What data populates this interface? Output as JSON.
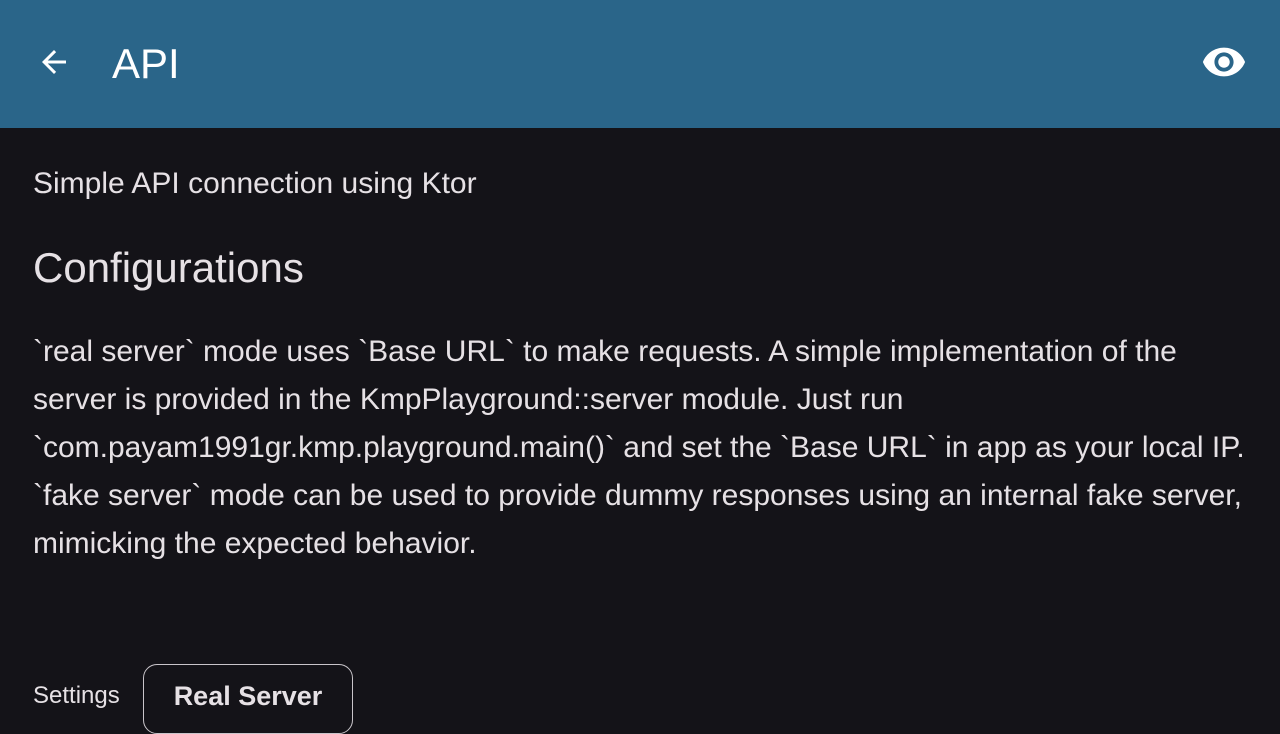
{
  "header": {
    "title": "API",
    "back_icon": "arrow-back-icon",
    "visibility_icon": "eye-icon"
  },
  "main": {
    "subtitle": "Simple API connection using Ktor",
    "section_title": "Configurations",
    "paragraphs": [
      "`real server` mode uses `Base URL` to make requests. A simple implementation of the server is provided in the KmpPlayground::server module. Just run `com.payam1991gr.kmp.playground.main()` and set the `Base URL` in app as your local IP.",
      "`fake server` mode can be used to provide dummy responses using an internal fake server, mimicking the expected behavior."
    ],
    "settings_label": "Settings",
    "server_mode_button": "Real Server"
  },
  "colors": {
    "appbar": "#2A6589",
    "background": "#141318",
    "text": "#E6E1E5",
    "outline": "#C9C5CA"
  }
}
